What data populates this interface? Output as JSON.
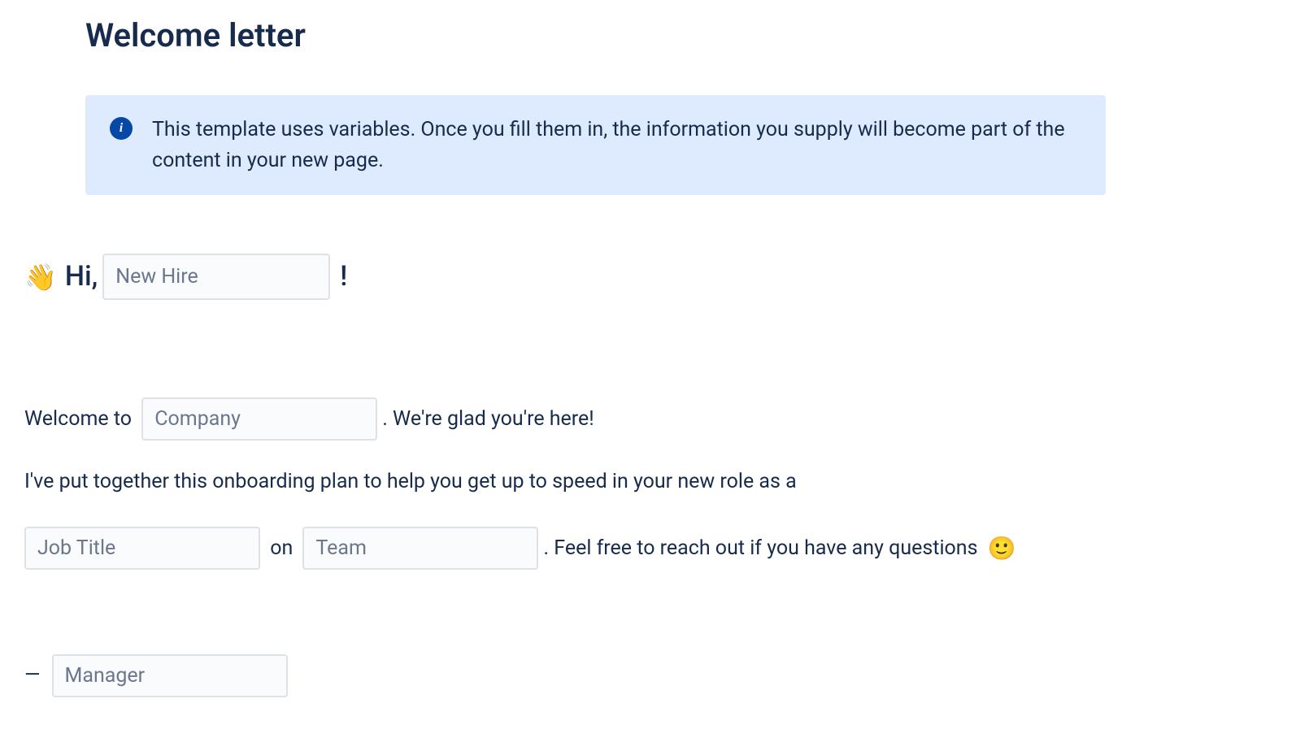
{
  "title": "Welcome letter",
  "info_panel": {
    "text": "This template uses variables. Once you fill them in, the information you supply will become part of the content in your new page."
  },
  "greeting": {
    "wave_emoji": "👋",
    "hi_text": "Hi, ",
    "exclamation": "!",
    "new_hire_placeholder": "New Hire"
  },
  "body": {
    "welcome_prefix": "Welcome to ",
    "company_placeholder": "Company",
    "welcome_suffix": ". We're glad you're here!",
    "onboarding_line": "I've put together this onboarding plan to help you get up to speed in your new role as a",
    "job_title_placeholder": "Job Title",
    "on_text": " on ",
    "team_placeholder": "Team",
    "reach_out_text": ". Feel free to reach out if you have any questions ",
    "smile_emoji": "🙂"
  },
  "signature": {
    "dash": "—",
    "manager_placeholder": "Manager"
  }
}
